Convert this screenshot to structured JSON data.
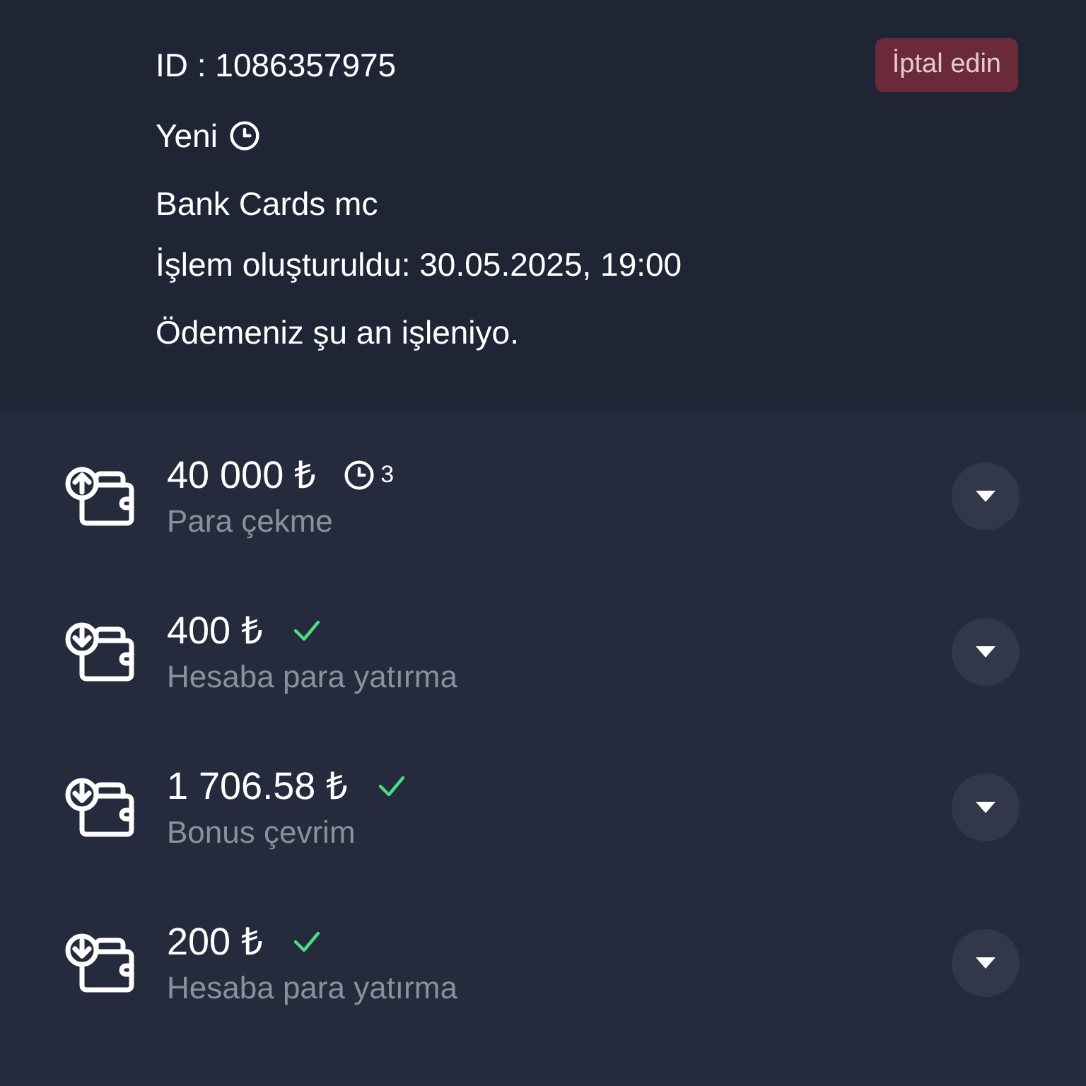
{
  "header": {
    "id_label": "ID : 1086357975",
    "cancel_button": "İptal edin",
    "status": "Yeni",
    "method": "Bank Cards mc",
    "created": "İşlem oluşturuldu: 30.05.2025, 19:00",
    "message": "Ödemeniz şu an işleniyo."
  },
  "transactions": [
    {
      "kind": "withdrawal",
      "amount": "40 000 ₺",
      "completed": false,
      "attempts": "3",
      "label": "Para çekme"
    },
    {
      "kind": "deposit",
      "amount": "400 ₺",
      "completed": true,
      "label": "Hesaba para yatırma"
    },
    {
      "kind": "deposit",
      "amount": "1 706.58 ₺",
      "completed": true,
      "label": "Bonus çevrim"
    },
    {
      "kind": "deposit",
      "amount": "200 ₺",
      "completed": true,
      "label": "Hesaba para yatırma"
    }
  ]
}
